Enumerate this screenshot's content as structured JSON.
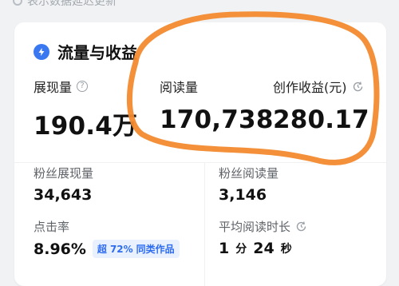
{
  "header": {
    "update_note": "表示数据延迟更新"
  },
  "card": {
    "title": "流量与收益",
    "metrics": [
      {
        "label": "展现量",
        "value": "190.4万"
      },
      {
        "label": "阅读量",
        "value": "170,738"
      },
      {
        "label": "创作收益(元)",
        "value": "280.17"
      }
    ],
    "sub_metrics": [
      {
        "label": "粉丝展现量",
        "value": "34,643"
      },
      {
        "label": "粉丝阅读量",
        "value": "3,146"
      },
      {
        "label": "点击率",
        "value": "8.96%"
      },
      {
        "label": "平均阅读时长",
        "value_main": "1",
        "unit_min": "分",
        "value_sec": "24",
        "unit_sec": "秒"
      }
    ],
    "click_rate_badge": {
      "prefix": "超",
      "percent": "72%",
      "suffix": "同类作品"
    }
  },
  "colors": {
    "accent_blue": "#3a78f2",
    "annotation_orange": "#f28a2e"
  },
  "icons": [
    "bolt-icon",
    "question-icon",
    "refresh-icon",
    "clock-icon"
  ]
}
